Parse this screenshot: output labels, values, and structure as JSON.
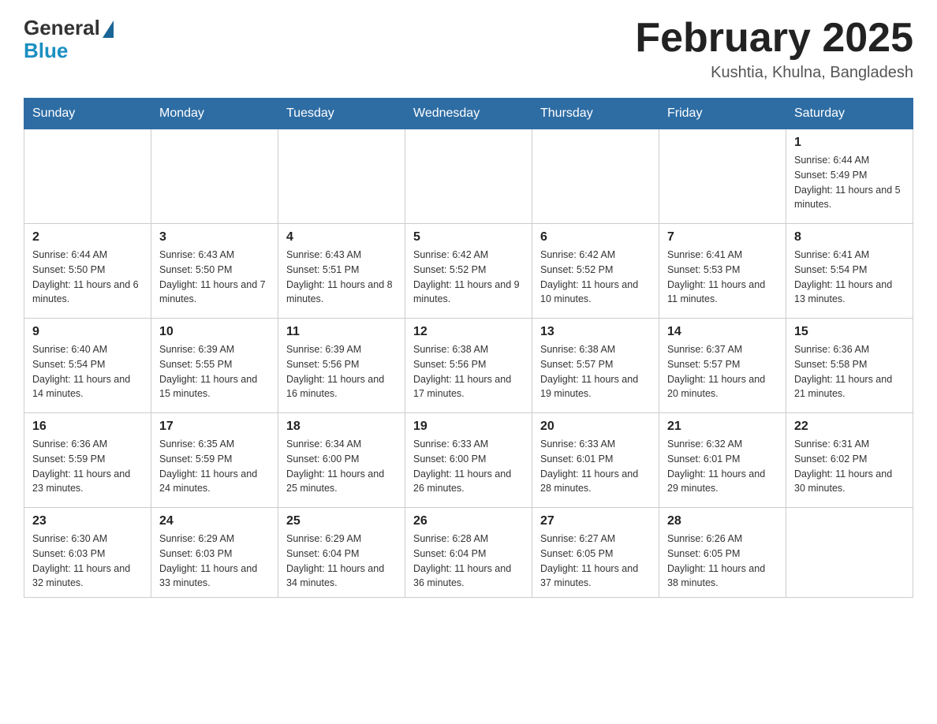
{
  "logo": {
    "general": "General",
    "blue": "Blue"
  },
  "header": {
    "title": "February 2025",
    "location": "Kushtia, Khulna, Bangladesh"
  },
  "days_of_week": [
    "Sunday",
    "Monday",
    "Tuesday",
    "Wednesday",
    "Thursday",
    "Friday",
    "Saturday"
  ],
  "weeks": [
    [
      {
        "day": "",
        "info": ""
      },
      {
        "day": "",
        "info": ""
      },
      {
        "day": "",
        "info": ""
      },
      {
        "day": "",
        "info": ""
      },
      {
        "day": "",
        "info": ""
      },
      {
        "day": "",
        "info": ""
      },
      {
        "day": "1",
        "info": "Sunrise: 6:44 AM\nSunset: 5:49 PM\nDaylight: 11 hours and 5 minutes."
      }
    ],
    [
      {
        "day": "2",
        "info": "Sunrise: 6:44 AM\nSunset: 5:50 PM\nDaylight: 11 hours and 6 minutes."
      },
      {
        "day": "3",
        "info": "Sunrise: 6:43 AM\nSunset: 5:50 PM\nDaylight: 11 hours and 7 minutes."
      },
      {
        "day": "4",
        "info": "Sunrise: 6:43 AM\nSunset: 5:51 PM\nDaylight: 11 hours and 8 minutes."
      },
      {
        "day": "5",
        "info": "Sunrise: 6:42 AM\nSunset: 5:52 PM\nDaylight: 11 hours and 9 minutes."
      },
      {
        "day": "6",
        "info": "Sunrise: 6:42 AM\nSunset: 5:52 PM\nDaylight: 11 hours and 10 minutes."
      },
      {
        "day": "7",
        "info": "Sunrise: 6:41 AM\nSunset: 5:53 PM\nDaylight: 11 hours and 11 minutes."
      },
      {
        "day": "8",
        "info": "Sunrise: 6:41 AM\nSunset: 5:54 PM\nDaylight: 11 hours and 13 minutes."
      }
    ],
    [
      {
        "day": "9",
        "info": "Sunrise: 6:40 AM\nSunset: 5:54 PM\nDaylight: 11 hours and 14 minutes."
      },
      {
        "day": "10",
        "info": "Sunrise: 6:39 AM\nSunset: 5:55 PM\nDaylight: 11 hours and 15 minutes."
      },
      {
        "day": "11",
        "info": "Sunrise: 6:39 AM\nSunset: 5:56 PM\nDaylight: 11 hours and 16 minutes."
      },
      {
        "day": "12",
        "info": "Sunrise: 6:38 AM\nSunset: 5:56 PM\nDaylight: 11 hours and 17 minutes."
      },
      {
        "day": "13",
        "info": "Sunrise: 6:38 AM\nSunset: 5:57 PM\nDaylight: 11 hours and 19 minutes."
      },
      {
        "day": "14",
        "info": "Sunrise: 6:37 AM\nSunset: 5:57 PM\nDaylight: 11 hours and 20 minutes."
      },
      {
        "day": "15",
        "info": "Sunrise: 6:36 AM\nSunset: 5:58 PM\nDaylight: 11 hours and 21 minutes."
      }
    ],
    [
      {
        "day": "16",
        "info": "Sunrise: 6:36 AM\nSunset: 5:59 PM\nDaylight: 11 hours and 23 minutes."
      },
      {
        "day": "17",
        "info": "Sunrise: 6:35 AM\nSunset: 5:59 PM\nDaylight: 11 hours and 24 minutes."
      },
      {
        "day": "18",
        "info": "Sunrise: 6:34 AM\nSunset: 6:00 PM\nDaylight: 11 hours and 25 minutes."
      },
      {
        "day": "19",
        "info": "Sunrise: 6:33 AM\nSunset: 6:00 PM\nDaylight: 11 hours and 26 minutes."
      },
      {
        "day": "20",
        "info": "Sunrise: 6:33 AM\nSunset: 6:01 PM\nDaylight: 11 hours and 28 minutes."
      },
      {
        "day": "21",
        "info": "Sunrise: 6:32 AM\nSunset: 6:01 PM\nDaylight: 11 hours and 29 minutes."
      },
      {
        "day": "22",
        "info": "Sunrise: 6:31 AM\nSunset: 6:02 PM\nDaylight: 11 hours and 30 minutes."
      }
    ],
    [
      {
        "day": "23",
        "info": "Sunrise: 6:30 AM\nSunset: 6:03 PM\nDaylight: 11 hours and 32 minutes."
      },
      {
        "day": "24",
        "info": "Sunrise: 6:29 AM\nSunset: 6:03 PM\nDaylight: 11 hours and 33 minutes."
      },
      {
        "day": "25",
        "info": "Sunrise: 6:29 AM\nSunset: 6:04 PM\nDaylight: 11 hours and 34 minutes."
      },
      {
        "day": "26",
        "info": "Sunrise: 6:28 AM\nSunset: 6:04 PM\nDaylight: 11 hours and 36 minutes."
      },
      {
        "day": "27",
        "info": "Sunrise: 6:27 AM\nSunset: 6:05 PM\nDaylight: 11 hours and 37 minutes."
      },
      {
        "day": "28",
        "info": "Sunrise: 6:26 AM\nSunset: 6:05 PM\nDaylight: 11 hours and 38 minutes."
      },
      {
        "day": "",
        "info": ""
      }
    ]
  ]
}
